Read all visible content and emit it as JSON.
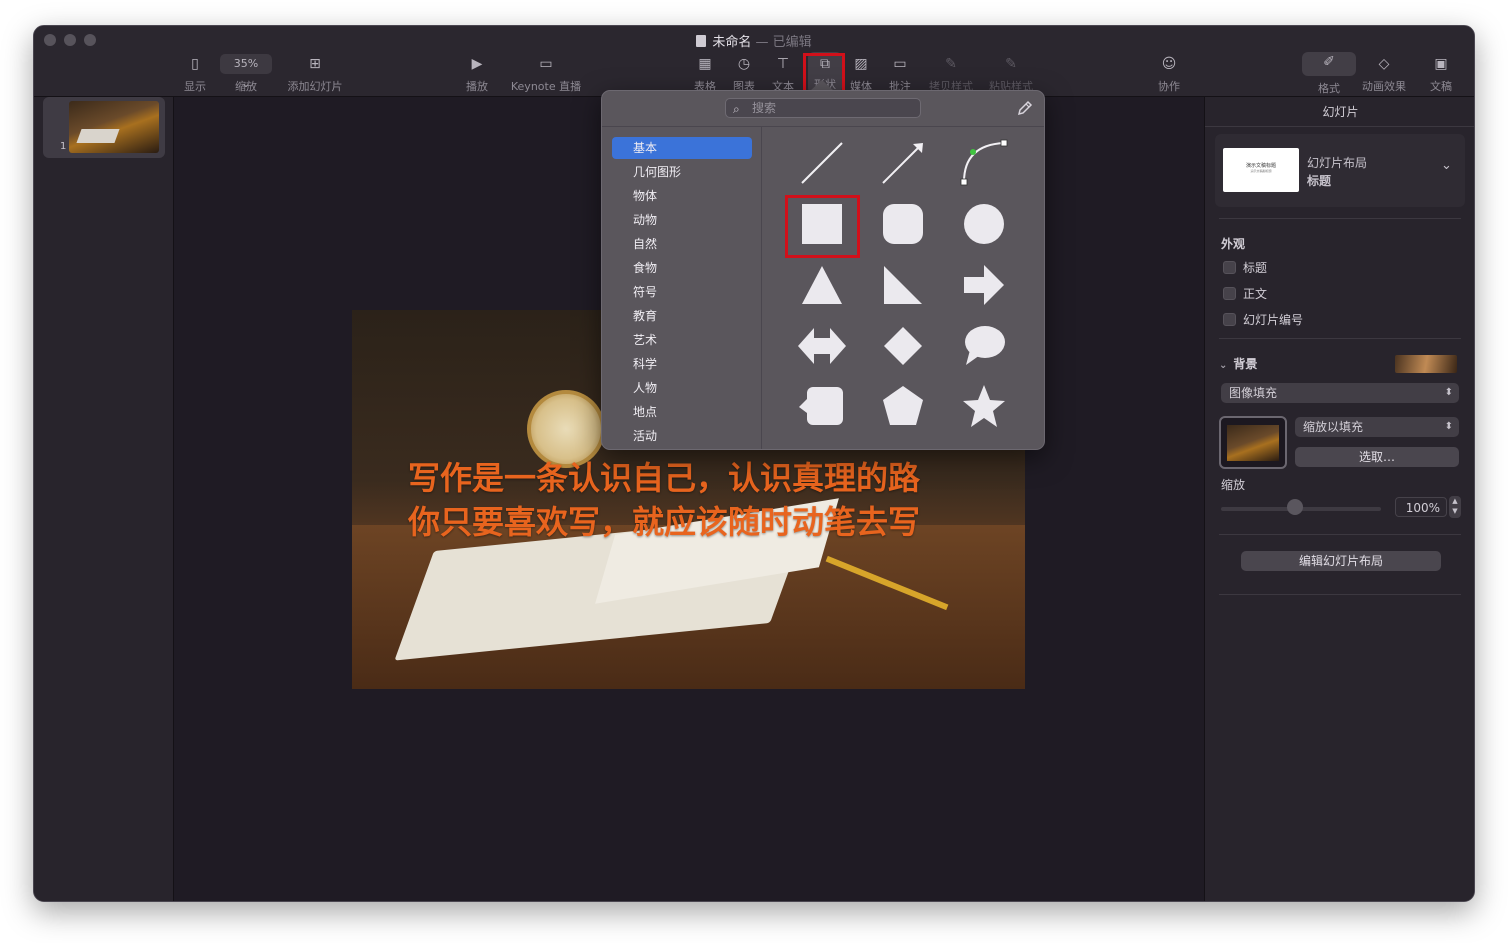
{
  "window": {
    "doc_name": "未命名",
    "separator": "—",
    "doc_status": "已编辑"
  },
  "toolbar": {
    "view_label": "显示",
    "zoom_value": "35% ⌄",
    "zoom_label": "缩放",
    "add_slide_label": "添加幻灯片",
    "play_label": "播放",
    "keynote_live_label": "Keynote 直播",
    "table_label": "表格",
    "chart_label": "图表",
    "text_label": "文本",
    "shape_label": "形状",
    "media_label": "媒体",
    "comment_label": "批注",
    "copy_style_label": "拷贝样式",
    "paste_style_label": "粘贴样式",
    "collaborate_label": "协作",
    "format_label": "格式",
    "animate_label": "动画效果",
    "document_label": "文稿"
  },
  "navigator": {
    "slides": [
      {
        "number": "1"
      }
    ]
  },
  "slide": {
    "line1": "写作是一条认识自己，认识真理的路",
    "line2": "你只要喜欢写，就应该随时动笔去写",
    "text_color": "#e8641e"
  },
  "shape_popover": {
    "search_placeholder": "搜索",
    "categories": [
      "基本",
      "几何图形",
      "物体",
      "动物",
      "自然",
      "食物",
      "符号",
      "教育",
      "艺术",
      "科学",
      "人物",
      "地点",
      "活动"
    ],
    "selected_category": "基本",
    "selection_color": "#3b73d9",
    "shapes": [
      "line",
      "arrow-line",
      "curve",
      "square",
      "rounded-square",
      "circle",
      "triangle",
      "right-triangle",
      "arrow",
      "double-arrow",
      "diamond",
      "speech-bubble",
      "callout-square",
      "pentagon",
      "star"
    ]
  },
  "inspector": {
    "title": "幻灯片",
    "layout_thumb_title": "演示文稿标题",
    "layout_thumb_sub": "演示文稿副标题",
    "layout_label": "幻灯片布局",
    "layout_value": "标题",
    "appearance_label": "外观",
    "appearance_items": [
      "标题",
      "正文",
      "幻灯片编号"
    ],
    "background_label": "背景",
    "fill_type": "图像填充",
    "scale_mode": "缩放以填充",
    "choose_button": "选取…",
    "scale_label": "缩放",
    "scale_value": "100%",
    "edit_layout_button": "编辑幻灯片布局"
  },
  "highlight_color": "#d1101a"
}
